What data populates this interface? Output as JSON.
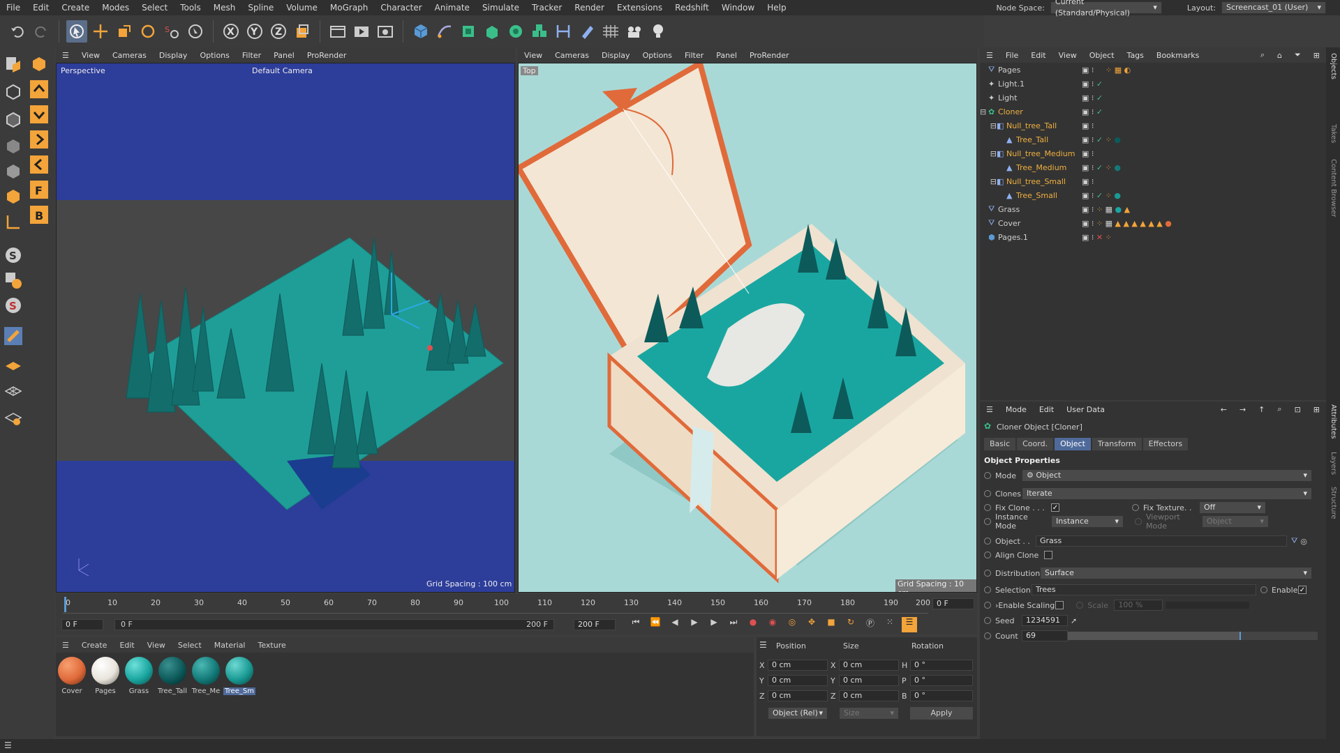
{
  "menu": {
    "items": [
      "File",
      "Edit",
      "Create",
      "Modes",
      "Select",
      "Tools",
      "Mesh",
      "Spline",
      "Volume",
      "MoGraph",
      "Character",
      "Animate",
      "Simulate",
      "Tracker",
      "Render",
      "Extensions",
      "Redshift",
      "Window",
      "Help"
    ],
    "node_space_label": "Node Space:",
    "node_space_value": "Current (Standard/Physical)",
    "layout_label": "Layout:",
    "layout_value": "Screencast_01 (User)"
  },
  "toolbar": {
    "icons": [
      "undo-icon",
      "redo-icon",
      "select-icon",
      "move-icon",
      "scale-icon",
      "rotate-icon",
      "recent-icon",
      "live-select-icon",
      "x-axis-icon",
      "y-axis-icon",
      "z-axis-icon",
      "world-coords-icon",
      "render-region-icon",
      "render-view-icon",
      "render-settings-icon",
      "cube-icon",
      "pen-icon",
      "subdivision-icon",
      "extrude-icon",
      "cloner-icon",
      "mograph-icon",
      "deformer-icon",
      "field-icon",
      "floor-icon",
      "camera-icon",
      "light-icon"
    ],
    "x_label": "X",
    "y_label": "Y",
    "z_label": "Z"
  },
  "viewport_menu": [
    "View",
    "Cameras",
    "Display",
    "Options",
    "Filter",
    "Panel",
    "ProRender"
  ],
  "viewport_left": {
    "label": "Perspective",
    "camera": "Default Camera",
    "grid": "Grid Spacing : 100 cm"
  },
  "viewport_right": {
    "label": "Top",
    "grid": "Grid Spacing : 10 cm"
  },
  "timeline": {
    "ticks": [
      "0",
      "10",
      "20",
      "30",
      "40",
      "50",
      "60",
      "70",
      "80",
      "90",
      "100",
      "110",
      "120",
      "130",
      "140",
      "150",
      "160",
      "170",
      "180",
      "190",
      "200"
    ],
    "end_field": "0 F",
    "start_field": "0 F",
    "start_field2": "0 F",
    "end_frame": "200 F",
    "end_frame2": "200 F"
  },
  "objects_menu": [
    "File",
    "Edit",
    "View",
    "Object",
    "Tags",
    "Bookmarks"
  ],
  "objects": [
    {
      "name": "Pages",
      "indent": 0,
      "color": "#cfcfcf"
    },
    {
      "name": "Light.1",
      "indent": 0,
      "color": "#cfcfcf"
    },
    {
      "name": "Light",
      "indent": 0,
      "color": "#cfcfcf"
    },
    {
      "name": "Cloner",
      "indent": 0,
      "color": "#f0b040"
    },
    {
      "name": "Null_tree_Tall",
      "indent": 1,
      "color": "#f0b040"
    },
    {
      "name": "Tree_Tall",
      "indent": 2,
      "color": "#f0b040"
    },
    {
      "name": "Null_tree_Medium",
      "indent": 1,
      "color": "#f0b040"
    },
    {
      "name": "Tree_Medium",
      "indent": 2,
      "color": "#f0b040"
    },
    {
      "name": "Null_tree_Small",
      "indent": 1,
      "color": "#f0b040"
    },
    {
      "name": "Tree_Small",
      "indent": 2,
      "color": "#f0b040"
    },
    {
      "name": "Grass",
      "indent": 0,
      "color": "#cfcfcf"
    },
    {
      "name": "Cover",
      "indent": 0,
      "color": "#cfcfcf"
    },
    {
      "name": "Pages.1",
      "indent": 0,
      "color": "#cfcfcf"
    }
  ],
  "attr_menu": [
    "Mode",
    "Edit",
    "User Data"
  ],
  "attr": {
    "title": "Cloner Object [Cloner]",
    "tabs": [
      "Basic",
      "Coord.",
      "Object",
      "Transform",
      "Effectors"
    ],
    "section": "Object Properties",
    "mode_label": "Mode",
    "mode_value": "Object",
    "clones_label": "Clones",
    "clones_value": "Iterate",
    "fixclone_label": "Fix Clone . . .",
    "fixtexture_label": "Fix Texture. .",
    "fixtexture_value": "Off",
    "instancemode_label": "Instance Mode",
    "instancemode_value": "Instance",
    "viewportmode_label": "Viewport Mode",
    "viewportmode_value": "Object",
    "object_label": "Object . .",
    "object_value": "Grass",
    "alignclone_label": "Align Clone",
    "distribution_label": "Distribution",
    "distribution_value": "Surface",
    "selection_label": "Selection",
    "selection_value": "Trees",
    "enable_label": "Enable",
    "enablescaling_label": "Enable Scaling",
    "scale_label": "Scale",
    "scale_value": "100 %",
    "seed_label": "Seed",
    "seed_value": "1234591",
    "count_label": "Count",
    "count_value": "69"
  },
  "material_menu": [
    "Create",
    "Edit",
    "View",
    "Select",
    "Material",
    "Texture"
  ],
  "materials": [
    {
      "name": "Cover",
      "color": "#e06a3a"
    },
    {
      "name": "Pages",
      "color": "#e8e4dc"
    },
    {
      "name": "Grass",
      "color": "#1aa6a0"
    },
    {
      "name": "Tree_Tall",
      "color": "#0d5a5a"
    },
    {
      "name": "Tree_Me",
      "color": "#137a78"
    },
    {
      "name": "Tree_Sm",
      "color": "#1a9a94"
    }
  ],
  "coords": {
    "position": "Position",
    "size": "Size",
    "rotation": "Rotation",
    "x": "X",
    "y": "Y",
    "z": "Z",
    "h": "H",
    "p": "P",
    "b": "B",
    "px": "0 cm",
    "py": "0 cm",
    "pz": "0 cm",
    "sx": "0 cm",
    "sy": "0 cm",
    "sz": "0 cm",
    "rh": "0 °",
    "rp": "0 °",
    "rb": "0 °",
    "mode": "Object (Rel)",
    "size_mode": "Size",
    "apply": "Apply"
  }
}
